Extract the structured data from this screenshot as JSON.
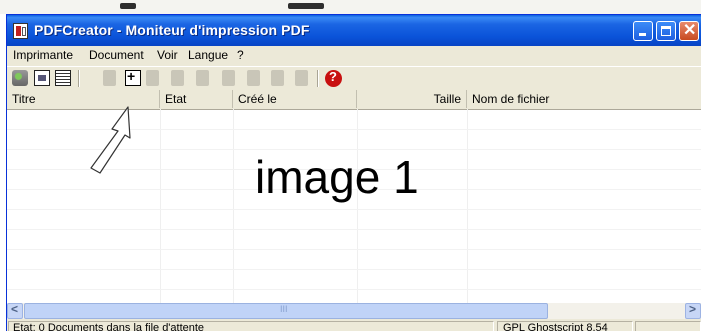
{
  "window": {
    "title": "PDFCreator - Moniteur d'impression PDF",
    "close_glyph": "✕"
  },
  "menu": [
    "Imprimante",
    "Document",
    "Voir",
    "Langue",
    "?"
  ],
  "toolbar": {
    "icons": [
      "printer-icon",
      "document-icon",
      "document-list-icon",
      "add-document-icon",
      "move-top-icon",
      "move-up-icon",
      "move-down-icon",
      "move-bottom-icon",
      "combine-icon",
      "save-icon",
      "help-icon"
    ],
    "add_glyph": "+",
    "help_glyph": "?"
  },
  "list": {
    "columns": [
      "Titre",
      "Etat",
      "Créé le",
      "Taille",
      "Nom de fichier"
    ]
  },
  "annotation": "image 1",
  "scrollbar": {
    "left_glyph": "<",
    "right_glyph": ">",
    "grip": "III"
  },
  "status": {
    "left": "Etat: 0 Documents dans la file d'attente",
    "right": "GPL Ghostscript 8.54"
  },
  "colors": {
    "titlebar": "#0a53d9",
    "window": "#ece9d8",
    "close_button": "#c84a20",
    "help_icon": "#c81010"
  }
}
